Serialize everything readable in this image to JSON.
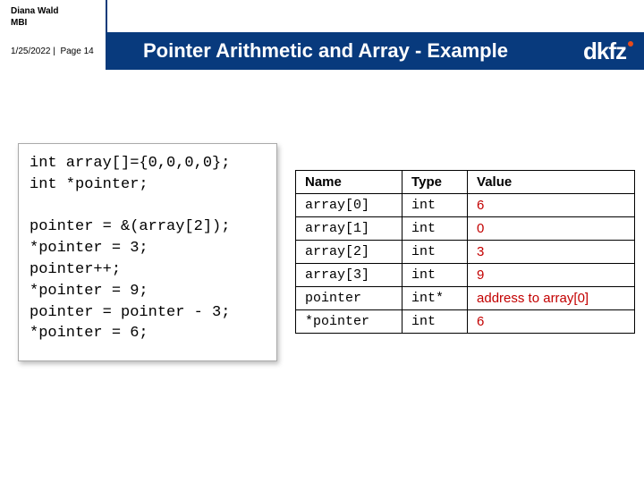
{
  "header": {
    "author": "Diana Wald",
    "dept": "MBI",
    "date": "1/25/2022",
    "page": "Page 14",
    "title": "Pointer Arithmetic and Array - Example",
    "logo": "dkfz"
  },
  "code": "int array[]={0,0,0,0};\nint *pointer;\n\npointer = &(array[2]);\n*pointer = 3;\npointer++;\n*pointer = 9;\npointer = pointer - 3;\n*pointer = 6;",
  "table": {
    "headers": {
      "c0": "Name",
      "c1": "Type",
      "c2": "Value"
    },
    "rows": [
      {
        "name": "array[0]",
        "type": "int",
        "value": "6"
      },
      {
        "name": "array[1]",
        "type": "int",
        "value": "0"
      },
      {
        "name": "array[2]",
        "type": "int",
        "value": "3"
      },
      {
        "name": "array[3]",
        "type": "int",
        "value": "9"
      },
      {
        "name": "pointer",
        "type": "int*",
        "value": "address to array[0]"
      },
      {
        "name": "*pointer",
        "type": "int",
        "value": "6"
      }
    ]
  }
}
